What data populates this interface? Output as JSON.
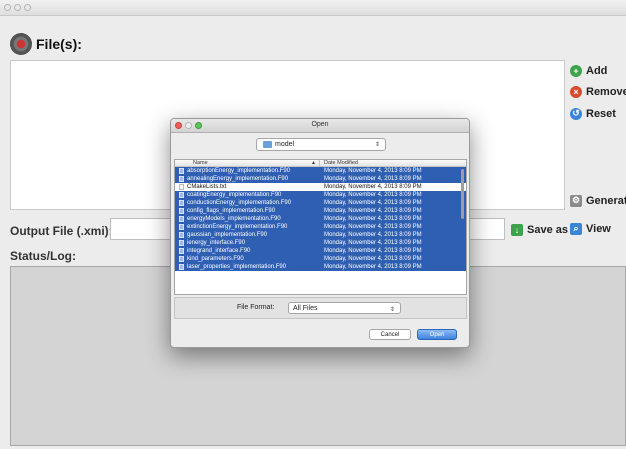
{
  "main": {
    "files_title": "File(s):",
    "buttons": {
      "add": "Add",
      "remove": "Remove",
      "reset": "Reset",
      "generate": "Generate",
      "view": "View",
      "save_as": "Save as"
    },
    "output_label": "Output File (.xmi):",
    "output_value": "",
    "status_label": "Status/Log:"
  },
  "dialog": {
    "title": "Open",
    "folder": "model",
    "columns": {
      "name": "Name",
      "date": "Date Modified"
    },
    "files": [
      {
        "name": "absorptionEnergy_implementation.F90",
        "date": "Monday, November 4, 2013 8:09 PM",
        "selected": true
      },
      {
        "name": "annealingEnergy_implementation.F90",
        "date": "Monday, November 4, 2013 8:09 PM",
        "selected": true
      },
      {
        "name": "CMakeLists.txt",
        "date": "Monday, November 4, 2013 8:09 PM",
        "selected": false
      },
      {
        "name": "coatingEnergy_implementation.F90",
        "date": "Monday, November 4, 2013 8:09 PM",
        "selected": true
      },
      {
        "name": "conductionEnergy_implementation.F90",
        "date": "Monday, November 4, 2013 8:09 PM",
        "selected": true
      },
      {
        "name": "config_flags_implementation.F90",
        "date": "Monday, November 4, 2013 8:09 PM",
        "selected": true
      },
      {
        "name": "energyModels_implementation.F90",
        "date": "Monday, November 4, 2013 8:09 PM",
        "selected": true
      },
      {
        "name": "extinctionEnergy_implementation.F90",
        "date": "Monday, November 4, 2013 8:09 PM",
        "selected": true
      },
      {
        "name": "gaussian_implementation.F90",
        "date": "Monday, November 4, 2013 8:09 PM",
        "selected": true
      },
      {
        "name": "ienergy_interface.F90",
        "date": "Monday, November 4, 2013 8:09 PM",
        "selected": true
      },
      {
        "name": "integrand_interface.F90",
        "date": "Monday, November 4, 2013 8:09 PM",
        "selected": true
      },
      {
        "name": "kind_parameters.F90",
        "date": "Monday, November 4, 2013 8:09 PM",
        "selected": true
      },
      {
        "name": "laser_properties_implementation.F90",
        "date": "Monday, November 4, 2013 8:09 PM",
        "selected": true
      }
    ],
    "format_label": "File Format:",
    "format_value": "All Files",
    "cancel": "Cancel",
    "open": "Open"
  },
  "colors": {
    "selection": "#2f5fb3",
    "open_button": "#3d83dc",
    "add_icon": "#3da34a",
    "remove_icon": "#d94b2e",
    "reset_icon": "#3a85d6"
  }
}
